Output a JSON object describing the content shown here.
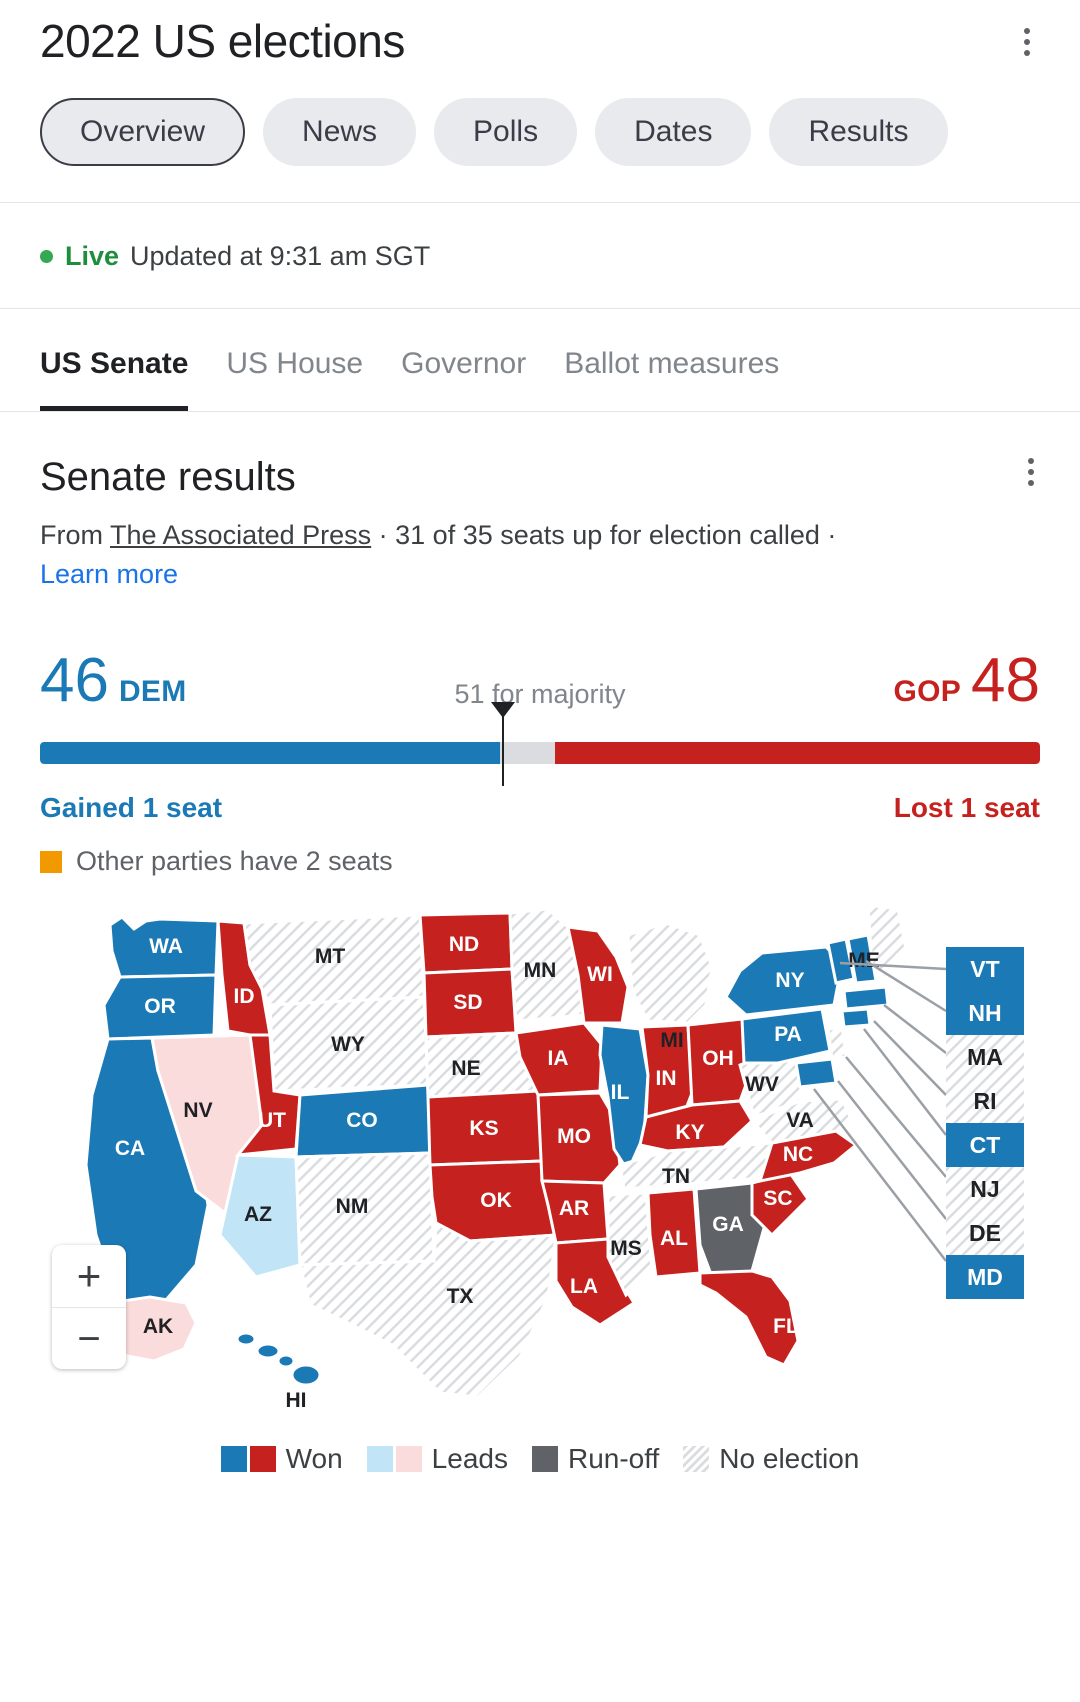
{
  "header": {
    "title": "2022 US elections",
    "menu_icon": "kebab-menu-icon"
  },
  "chips": [
    {
      "label": "Overview",
      "active": true
    },
    {
      "label": "News",
      "active": false
    },
    {
      "label": "Polls",
      "active": false
    },
    {
      "label": "Dates",
      "active": false
    },
    {
      "label": "Results",
      "active": false
    }
  ],
  "live": {
    "status": "Live",
    "updated": "Updated at 9:31 am SGT"
  },
  "race_tabs": [
    {
      "label": "US Senate",
      "active": true
    },
    {
      "label": "US House",
      "active": false
    },
    {
      "label": "Governor",
      "active": false
    },
    {
      "label": "Ballot measures",
      "active": false
    }
  ],
  "results": {
    "title": "Senate results",
    "menu_icon": "kebab-menu-icon",
    "source_prefix": "From ",
    "source_name": "The Associated Press",
    "source_middle": " · 31 of 35 seats up for election called · ",
    "learn_more": "Learn more"
  },
  "seats": {
    "dem_count": "46",
    "dem_label": "DEM",
    "gop_count": "48",
    "gop_label": "GOP",
    "majority_label": "51 for majority",
    "dem_change": "Gained 1 seat",
    "gop_change": "Lost 1 seat",
    "other_parties": "Other parties have 2 seats",
    "colors": {
      "dem": "#1b7ab5",
      "gop": "#c5221f",
      "other": "#f29900",
      "track": "#dadce0"
    }
  },
  "map": {
    "zoom_in": "+",
    "zoom_out": "−",
    "states": [
      {
        "code": "WA",
        "status": "dem_won"
      },
      {
        "code": "OR",
        "status": "dem_won"
      },
      {
        "code": "CA",
        "status": "dem_won"
      },
      {
        "code": "NV",
        "status": "gop_leads"
      },
      {
        "code": "ID",
        "status": "gop_won"
      },
      {
        "code": "MT",
        "status": "no_election"
      },
      {
        "code": "WY",
        "status": "no_election"
      },
      {
        "code": "UT",
        "status": "gop_won"
      },
      {
        "code": "AZ",
        "status": "dem_leads"
      },
      {
        "code": "CO",
        "status": "dem_won"
      },
      {
        "code": "NM",
        "status": "no_election"
      },
      {
        "code": "ND",
        "status": "gop_won"
      },
      {
        "code": "SD",
        "status": "gop_won"
      },
      {
        "code": "NE",
        "status": "no_election"
      },
      {
        "code": "KS",
        "status": "gop_won"
      },
      {
        "code": "OK",
        "status": "gop_won"
      },
      {
        "code": "TX",
        "status": "no_election"
      },
      {
        "code": "MN",
        "status": "no_election"
      },
      {
        "code": "IA",
        "status": "gop_won"
      },
      {
        "code": "MO",
        "status": "gop_won"
      },
      {
        "code": "AR",
        "status": "gop_won"
      },
      {
        "code": "LA",
        "status": "gop_won"
      },
      {
        "code": "WI",
        "status": "gop_won"
      },
      {
        "code": "IL",
        "status": "dem_won"
      },
      {
        "code": "IN",
        "status": "gop_won"
      },
      {
        "code": "MI",
        "status": "no_election"
      },
      {
        "code": "OH",
        "status": "gop_won"
      },
      {
        "code": "KY",
        "status": "gop_won"
      },
      {
        "code": "TN",
        "status": "no_election"
      },
      {
        "code": "MS",
        "status": "no_election"
      },
      {
        "code": "AL",
        "status": "gop_won"
      },
      {
        "code": "GA",
        "status": "runoff"
      },
      {
        "code": "SC",
        "status": "gop_won"
      },
      {
        "code": "NC",
        "status": "gop_won"
      },
      {
        "code": "VA",
        "status": "no_election"
      },
      {
        "code": "WV",
        "status": "no_election"
      },
      {
        "code": "PA",
        "status": "dem_won"
      },
      {
        "code": "NY",
        "status": "dem_won"
      },
      {
        "code": "FL",
        "status": "gop_won"
      },
      {
        "code": "AK",
        "status": "gop_leads"
      },
      {
        "code": "HI",
        "status": "dem_won"
      },
      {
        "code": "ME",
        "status": "no_election"
      }
    ],
    "callouts": [
      {
        "code": "VT",
        "status": "dem_won"
      },
      {
        "code": "NH",
        "status": "dem_won"
      },
      {
        "code": "MA",
        "status": "no_election"
      },
      {
        "code": "RI",
        "status": "no_election"
      },
      {
        "code": "CT",
        "status": "dem_won"
      },
      {
        "code": "NJ",
        "status": "no_election"
      },
      {
        "code": "DE",
        "status": "no_election"
      },
      {
        "code": "MD",
        "status": "dem_won"
      }
    ]
  },
  "legend": [
    {
      "label": "Won",
      "swatches": [
        "blue",
        "red"
      ]
    },
    {
      "label": "Leads",
      "swatches": [
        "ltblue",
        "ltpink"
      ]
    },
    {
      "label": "Run-off",
      "swatches": [
        "gray"
      ]
    },
    {
      "label": "No election",
      "swatches": [
        "hatch"
      ]
    }
  ]
}
